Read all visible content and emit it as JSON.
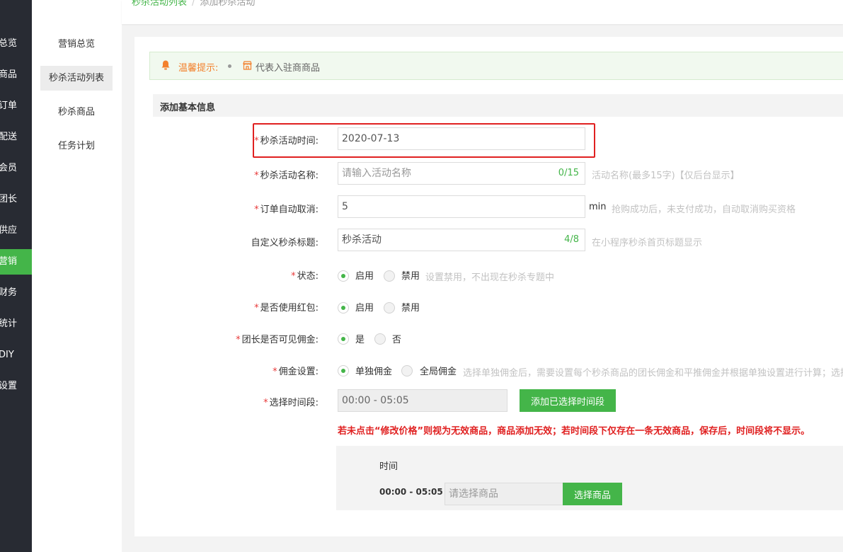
{
  "nav": {
    "items": [
      "总览",
      "商品",
      "订单",
      "配送",
      "会员",
      "团长",
      "供应",
      "营销",
      "财务",
      "统计",
      "DIY",
      "设置"
    ],
    "active_index": 7
  },
  "submenu": {
    "items": [
      "营销总览",
      "秒杀活动列表",
      "秒杀商品",
      "任务计划"
    ],
    "active_index": 1
  },
  "breadcrumb": {
    "parent": "秒杀活动列表",
    "separator": "/",
    "current": "添加秒杀活动"
  },
  "tip": {
    "label": "温馨提示:",
    "text": "代表入驻商商品"
  },
  "section": {
    "title": "添加基本信息"
  },
  "form": {
    "time": {
      "label": "秒杀活动时间:",
      "value": "2020-07-13"
    },
    "name": {
      "label": "秒杀活动名称:",
      "placeholder": "请输入活动名称",
      "count": "0/15",
      "help": "活动名称(最多15字)【仅后台显示】"
    },
    "cancel": {
      "label": "订单自动取消:",
      "value": "5",
      "unit": "min",
      "help": "抢购成功后，未支付成功，自动取消购买资格"
    },
    "title": {
      "label": "自定义秒杀标题:",
      "value": "秒杀活动",
      "count": "4/8",
      "help": "在小程序秒杀首页标题显示"
    },
    "status": {
      "label": "状态:",
      "opt1": "启用",
      "opt2": "禁用",
      "help": "设置禁用，不出现在秒杀专题中"
    },
    "redpack": {
      "label": "是否使用红包:",
      "opt1": "启用",
      "opt2": "禁用"
    },
    "commission_visible": {
      "label": "团长是否可见佣金:",
      "opt1": "是",
      "opt2": "否"
    },
    "commission_setting": {
      "label": "佣金设置:",
      "opt1": "单独佣金",
      "opt2": "全局佣金",
      "help": "选择单独佣金后，需要设置每个秒杀商品的团长佣金和平推佣金并根据单独设置进行计算；选择"
    },
    "period": {
      "label": "选择时间段:",
      "value": "00:00 - 05:05",
      "button": "添加已选择时间段"
    },
    "warning": "若未点击“修改价格”则视为无效商品，商品添加无效；若时间段下仅存在一条无效商品，保存后，时间段将不显示。",
    "table": {
      "header": "时间",
      "row_time": "00:00 - 05:05",
      "product_placeholder": "请选择商品",
      "select_button": "选择商品"
    }
  },
  "colors": {
    "accent": "#44b549",
    "nav_bg": "#282b33",
    "required": "#e83a3a",
    "warning": "#e02020",
    "tip": "#f3812d"
  }
}
